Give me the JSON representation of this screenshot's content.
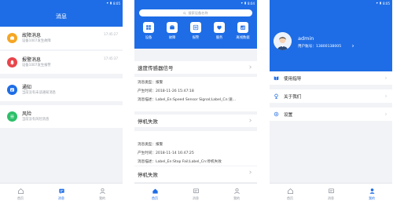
{
  "colors": {
    "primary": "#1e6de6",
    "tab_inactive": "#8a8f98",
    "warning": "#f5a623",
    "alarm": "#e8454a",
    "notice": "#1e6de6",
    "risk": "#2dbf6a"
  },
  "status_bar": {
    "time_1": "8:05",
    "time_2": "8:04",
    "time_3": "8:05"
  },
  "tabbar": {
    "items": [
      {
        "label": "首页",
        "icon": "home-icon"
      },
      {
        "label": "消息",
        "icon": "message-icon"
      },
      {
        "label": "我的",
        "icon": "person-icon"
      }
    ]
  },
  "messages_screen": {
    "title": "消息",
    "items": [
      {
        "title": "故障消息",
        "subtitle": "设备1007发生故障",
        "time": "17:45:27",
        "icon": "warning-icon"
      },
      {
        "title": "报警消息",
        "subtitle": "设备1007发生报警",
        "time": "17:45:37",
        "icon": "bell-icon"
      },
      {
        "title": "通知",
        "subtitle": "当前没有未读通知消息",
        "time": "",
        "icon": "notice-icon"
      },
      {
        "title": "风险",
        "subtitle": "当前没有风险消息",
        "time": "",
        "icon": "list-icon"
      }
    ]
  },
  "home_screen": {
    "search_placeholder": "搜索设备名称",
    "categories": [
      {
        "label": "设备",
        "icon": "device-icon"
      },
      {
        "label": "故障",
        "icon": "fault-icon"
      },
      {
        "label": "报警",
        "icon": "alarm-icon"
      },
      {
        "label": "服务",
        "icon": "service-icon"
      },
      {
        "label": "离线数据",
        "icon": "offline-data-icon"
      }
    ],
    "sections": [
      {
        "title": "速度传感器信号",
        "rows": [
          "消息类型：报警",
          "产生时间：2018-11-26 15:47:18",
          "消息描述：Label_En:Speed Sensor Signal;Label_Cn:速..."
        ]
      },
      {
        "title": "停机失败",
        "rows": [
          "消息类型：报警",
          "产生时间：2018-11-14 16:47:25",
          "消息描述：Label_En:Stop Fail;Label_Cn:停机失败"
        ]
      },
      {
        "title": "停机失败",
        "rows": []
      }
    ]
  },
  "profile_screen": {
    "username": "admin",
    "account": "用户账号：13800138005",
    "menu": [
      {
        "label": "使用指导",
        "icon": "book-icon"
      },
      {
        "label": "关于我们",
        "icon": "pin-icon"
      },
      {
        "label": "设置",
        "icon": "settings-icon"
      }
    ]
  }
}
